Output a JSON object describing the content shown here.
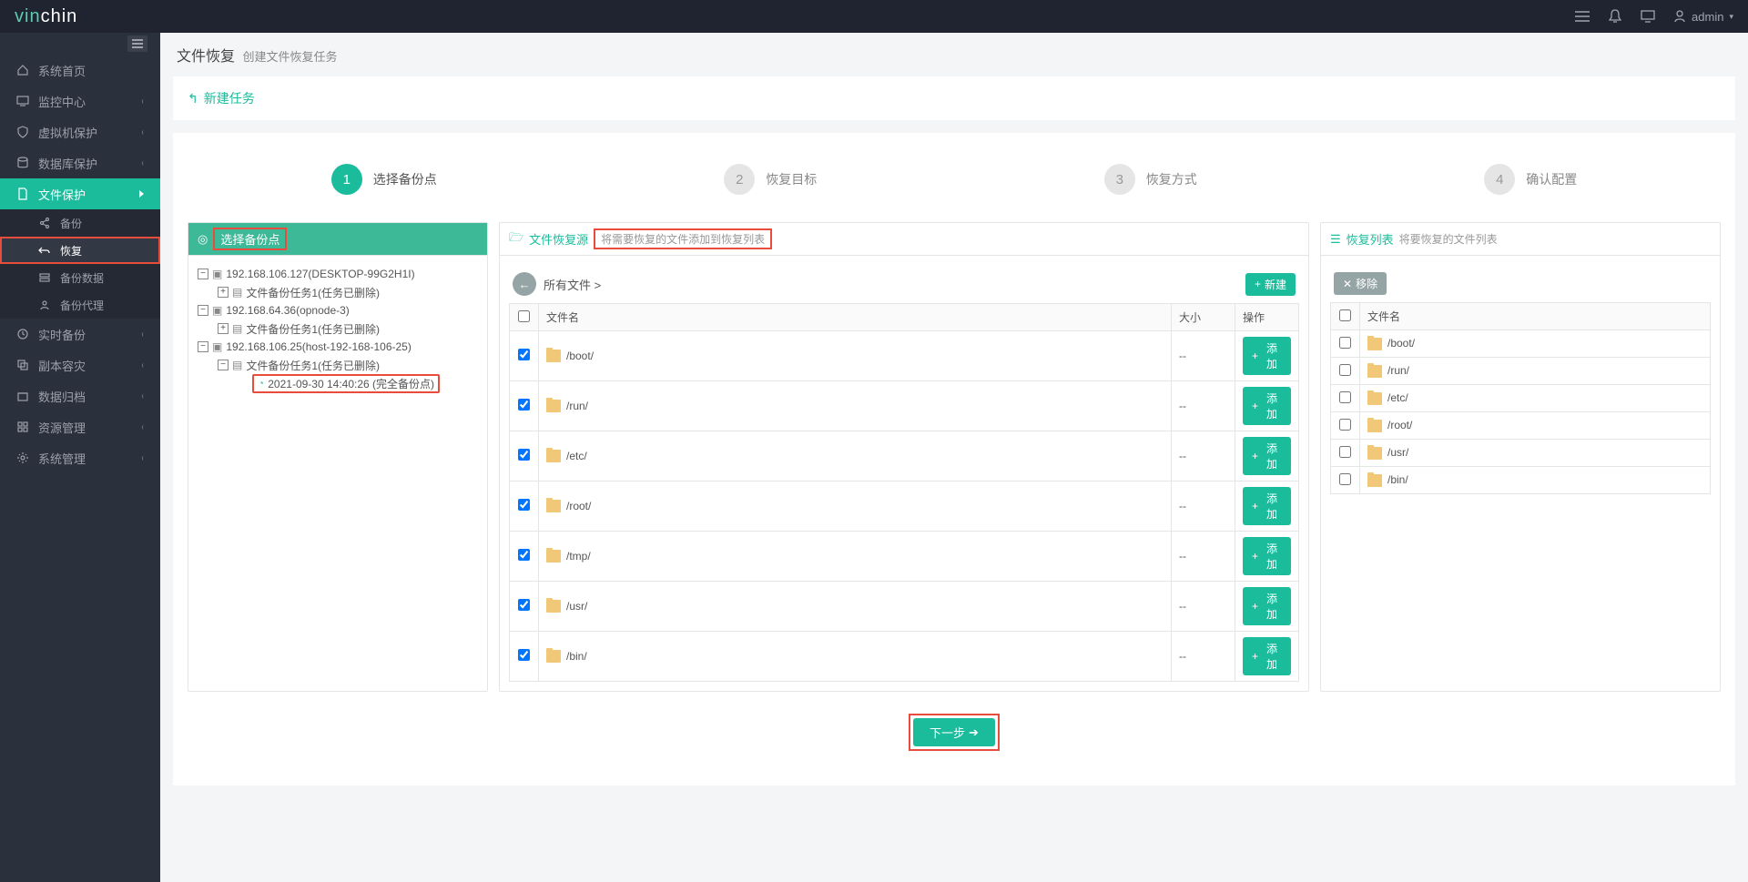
{
  "header": {
    "logo_pre": "vin",
    "logo_post": "chin",
    "user": "admin"
  },
  "sidebar": {
    "items": [
      {
        "icon": "home",
        "label": "系统首页",
        "chevron": false
      },
      {
        "icon": "monitor",
        "label": "监控中心",
        "chevron": true
      },
      {
        "icon": "shield",
        "label": "虚拟机保护",
        "chevron": true
      },
      {
        "icon": "db",
        "label": "数据库保护",
        "chevron": true
      },
      {
        "icon": "file",
        "label": "文件保护",
        "chevron": true,
        "active": true,
        "children": [
          {
            "icon": "share",
            "label": "备份"
          },
          {
            "icon": "undo",
            "label": "恢复",
            "selected": true,
            "highlight": true
          },
          {
            "icon": "data",
            "label": "备份数据"
          },
          {
            "icon": "agent",
            "label": "备份代理"
          }
        ]
      },
      {
        "icon": "rt",
        "label": "实时备份",
        "chevron": true
      },
      {
        "icon": "copy",
        "label": "副本容灾",
        "chevron": true
      },
      {
        "icon": "archive",
        "label": "数据归档",
        "chevron": true
      },
      {
        "icon": "resource",
        "label": "资源管理",
        "chevron": true
      },
      {
        "icon": "gear",
        "label": "系统管理",
        "chevron": true
      }
    ]
  },
  "breadcrumb": {
    "main": "文件恢复",
    "sub": "创建文件恢复任务"
  },
  "newTask": "新建任务",
  "steps": [
    {
      "num": "1",
      "label": "选择备份点",
      "active": true
    },
    {
      "num": "2",
      "label": "恢复目标"
    },
    {
      "num": "3",
      "label": "恢复方式"
    },
    {
      "num": "4",
      "label": "确认配置"
    }
  ],
  "col1": {
    "title": "选择备份点",
    "tree": {
      "n1": "192.168.106.127(DESKTOP-99G2H1I)",
      "n1_1": "文件备份任务1(任务已删除)",
      "n2": "192.168.64.36(opnode-3)",
      "n2_1": "文件备份任务1(任务已删除)",
      "n3": "192.168.106.25(host-192-168-106-25)",
      "n3_1": "文件备份任务1(任务已删除)",
      "n3_1_1": "2021-09-30 14:40:26 (完全备份点)"
    }
  },
  "col2": {
    "title": "文件恢复源",
    "subtitle": "将需要恢复的文件添加到恢复列表",
    "back": "所有文件",
    "newBtn": "新建",
    "addBtn": "添加",
    "headers": {
      "name": "文件名",
      "size": "大小",
      "op": "操作"
    },
    "rows": [
      {
        "name": "/boot/",
        "size": "--",
        "checked": true
      },
      {
        "name": "/run/",
        "size": "--",
        "checked": true
      },
      {
        "name": "/etc/",
        "size": "--",
        "checked": true
      },
      {
        "name": "/root/",
        "size": "--",
        "checked": true
      },
      {
        "name": "/tmp/",
        "size": "--",
        "checked": true
      },
      {
        "name": "/usr/",
        "size": "--",
        "checked": true
      },
      {
        "name": "/bin/",
        "size": "--",
        "checked": true
      }
    ]
  },
  "col3": {
    "title": "恢复列表",
    "subtitle": "将要恢复的文件列表",
    "removeBtn": "移除",
    "headers": {
      "name": "文件名"
    },
    "rows": [
      {
        "name": "/boot/"
      },
      {
        "name": "/run/"
      },
      {
        "name": "/etc/"
      },
      {
        "name": "/root/"
      },
      {
        "name": "/usr/"
      },
      {
        "name": "/bin/"
      }
    ]
  },
  "nextBtn": "下一步"
}
